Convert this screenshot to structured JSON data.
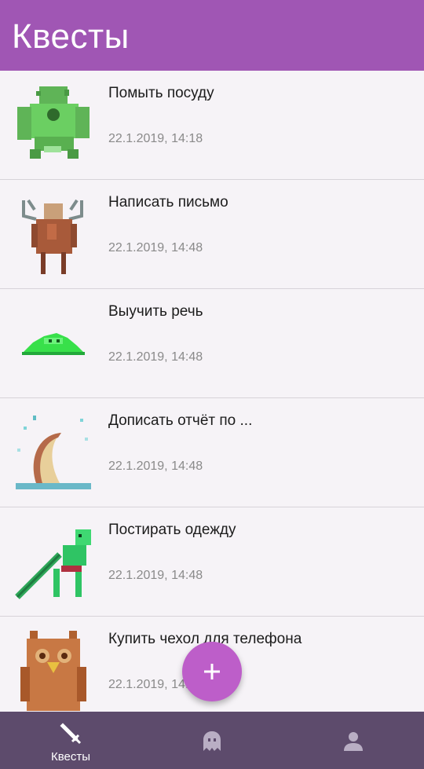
{
  "header": {
    "title": "Квесты"
  },
  "quests": [
    {
      "title": "Помыть посуду",
      "date": "22.1.2019, 14:18",
      "monster": "green-troll-icon"
    },
    {
      "title": "Написать письмо",
      "date": "22.1.2019, 14:48",
      "monster": "antlered-creature-icon"
    },
    {
      "title": "Выучить речь",
      "date": "22.1.2019, 14:48",
      "monster": "green-slime-icon"
    },
    {
      "title": "Дописать отчёт по ...",
      "date": "22.1.2019, 14:48",
      "monster": "sand-worm-icon"
    },
    {
      "title": "Постирать одежду",
      "date": "22.1.2019, 14:48",
      "monster": "skeleton-swordsman-icon"
    },
    {
      "title": "Купить чехол для телефона",
      "date": "22.1.2019, 14:48",
      "monster": "owl-bear-icon"
    }
  ],
  "fab": {
    "icon": "plus-icon"
  },
  "nav": {
    "quests_label": "Квесты",
    "quests_icon": "sword-icon",
    "ghost_icon": "ghost-icon",
    "profile_icon": "person-icon"
  }
}
